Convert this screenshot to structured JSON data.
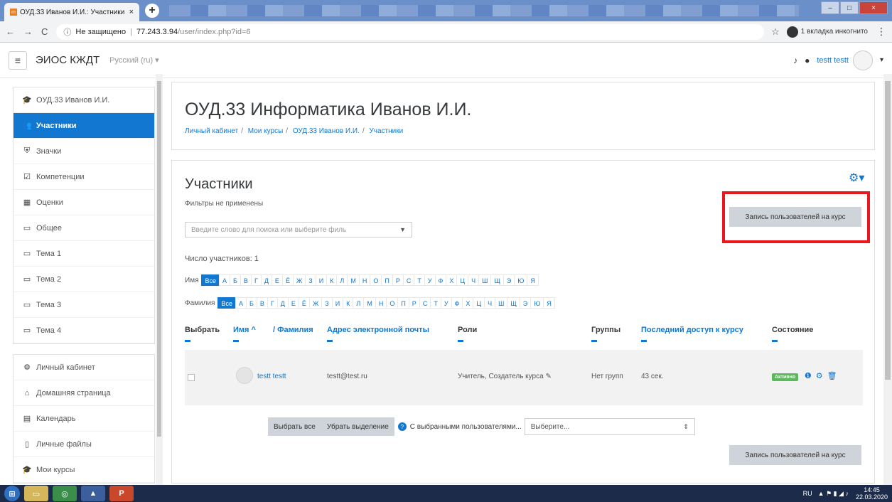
{
  "browser": {
    "tab_title": "ОУД.33 Иванов И.И.: Участники",
    "new_tab": "+",
    "url_security": "Не защищено",
    "url_host": "77.243.3.94",
    "url_path": "/user/index.php?id=6",
    "incognito": "1 вкладка инкогнито"
  },
  "navbar": {
    "brand": "ЭИОС КЖДТ",
    "language": "Русский (ru) ▾",
    "user": "testt testt"
  },
  "drawer": {
    "course": [
      {
        "label": "ОУД.33 Иванов И.И.",
        "icon": "graduation-cap-icon",
        "active": false
      },
      {
        "label": "Участники",
        "icon": "users-icon",
        "active": true
      },
      {
        "label": "Значки",
        "icon": "shield-icon",
        "active": false
      },
      {
        "label": "Компетенции",
        "icon": "checkbox-icon",
        "active": false
      },
      {
        "label": "Оценки",
        "icon": "table-icon",
        "active": false
      },
      {
        "label": "Общее",
        "icon": "folder-icon",
        "active": false
      },
      {
        "label": "Тема 1",
        "icon": "folder-icon",
        "active": false
      },
      {
        "label": "Тема 2",
        "icon": "folder-icon",
        "active": false
      },
      {
        "label": "Тема 3",
        "icon": "folder-icon",
        "active": false
      },
      {
        "label": "Тема 4",
        "icon": "folder-icon",
        "active": false
      }
    ],
    "site": [
      {
        "label": "Личный кабинет",
        "icon": "dashboard-icon"
      },
      {
        "label": "Домашняя страница",
        "icon": "home-icon"
      },
      {
        "label": "Календарь",
        "icon": "calendar-icon"
      },
      {
        "label": "Личные файлы",
        "icon": "file-icon"
      },
      {
        "label": "Мои курсы",
        "icon": "graduation-cap-icon"
      }
    ]
  },
  "header": {
    "title": "ОУД.33 Информатика Иванов И.И.",
    "breadcrumb": [
      "Личный кабинет",
      "Мои курсы",
      "ОУД.33 Иванов И.И.",
      "Участники"
    ]
  },
  "main": {
    "title": "Участники",
    "filters": "Фильтры не применены",
    "search_placeholder": "Введите слово для поиска или выберите филь",
    "enrol_button": "Запись пользователей на курс",
    "count": "Число участников: 1",
    "firstname_label": "Имя",
    "lastname_label": "Фамилия",
    "all": "Все",
    "letters": [
      "А",
      "Б",
      "В",
      "Г",
      "Д",
      "Е",
      "Ё",
      "Ж",
      "З",
      "И",
      "К",
      "Л",
      "М",
      "Н",
      "О",
      "П",
      "Р",
      "С",
      "Т",
      "У",
      "Ф",
      "Х",
      "Ц",
      "Ч",
      "Ш",
      "Щ",
      "Э",
      "Ю",
      "Я"
    ]
  },
  "table": {
    "columns": {
      "select": "Выбрать",
      "name": "Имя ^",
      "surname": "/ Фамилия",
      "email": "Адрес электронной почты",
      "roles": "Роли",
      "groups": "Группы",
      "last_access": "Последний доступ к курсу",
      "status": "Состояние"
    },
    "rows": [
      {
        "name": "testt testt",
        "email": "testt@test.ru",
        "roles": "Учитель, Создатель курса",
        "groups": "Нет групп",
        "last_access": "43 сек.",
        "status": "Активно"
      }
    ]
  },
  "bulk": {
    "select_all": "Выбрать все",
    "deselect": "Убрать выделение",
    "with_selected": "С выбранными пользователями...",
    "choose": "Выберите..."
  },
  "taskbar": {
    "lang": "RU",
    "time": "14:45",
    "date": "22.03.2020"
  }
}
